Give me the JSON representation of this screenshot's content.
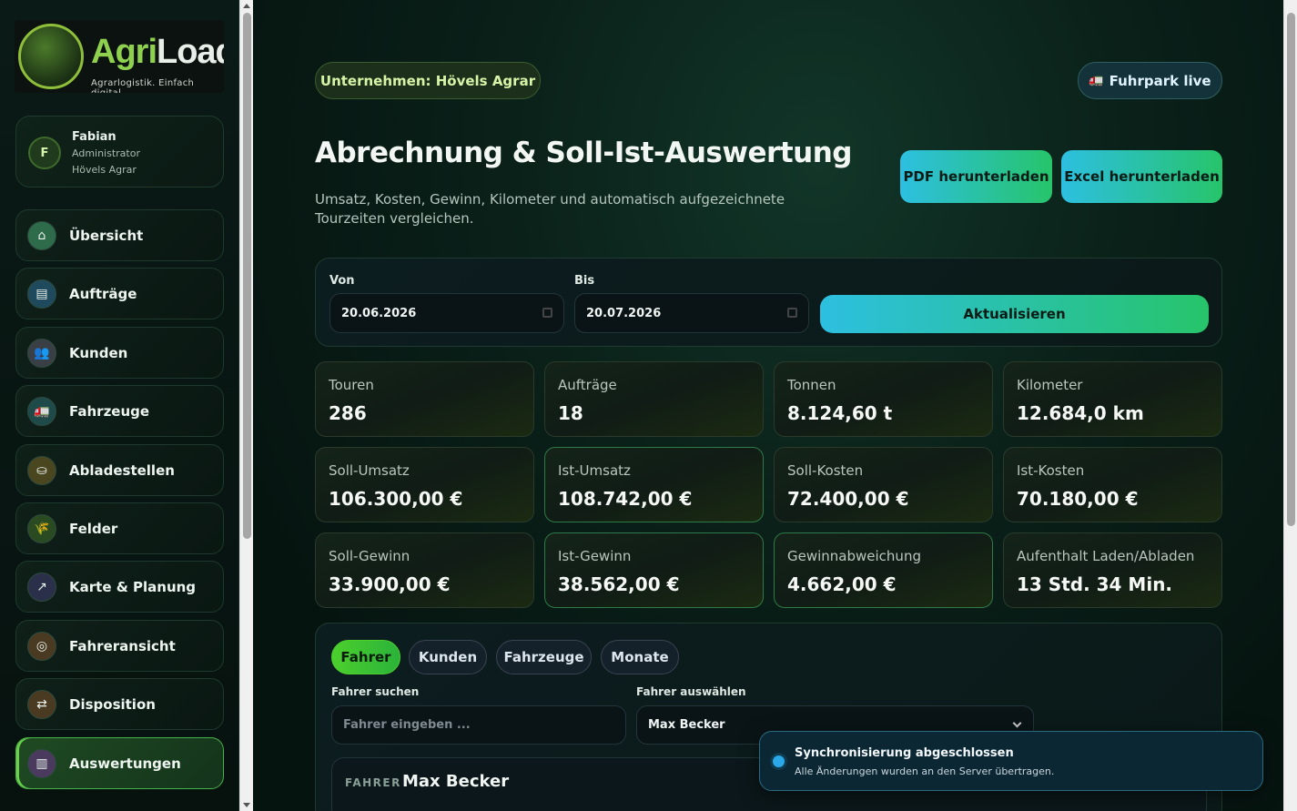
{
  "brand": {
    "name_a": "Agri",
    "name_b": "Load",
    "tagline": "Agrarlogistik. Einfach digital."
  },
  "user": {
    "initial": "F",
    "name": "Fabian",
    "role": "Administrator",
    "org": "Hövels Agrar"
  },
  "sidebar": {
    "items": [
      {
        "label": "Übersicht",
        "icon": "home-icon",
        "glyph": "⌂",
        "color": "#2e6b4a"
      },
      {
        "label": "Aufträge",
        "icon": "list-icon",
        "glyph": "▤",
        "color": "#1f4a5e"
      },
      {
        "label": "Kunden",
        "icon": "people-icon",
        "glyph": "👥",
        "color": "#3a3f46"
      },
      {
        "label": "Fahrzeuge",
        "icon": "truck-icon",
        "glyph": "🚛",
        "color": "#1f4a4a"
      },
      {
        "label": "Abladestellen",
        "icon": "silo-icon",
        "glyph": "⛀",
        "color": "#4a4620"
      },
      {
        "label": "Felder",
        "icon": "wheat-icon",
        "glyph": "🌾",
        "color": "#2a4a22"
      },
      {
        "label": "Karte & Planung",
        "icon": "map-icon",
        "glyph": "↗",
        "color": "#2a2f4a"
      },
      {
        "label": "Fahreransicht",
        "icon": "steering-icon",
        "glyph": "◎",
        "color": "#4a3a22"
      },
      {
        "label": "Disposition",
        "icon": "swap-icon",
        "glyph": "⇄",
        "color": "#4a3a22"
      },
      {
        "label": "Auswertungen",
        "icon": "chart-icon",
        "glyph": "▥",
        "color": "#4a3a5e"
      }
    ]
  },
  "header": {
    "company": "Unternehmen: Hövels Agrar",
    "fleet": "Fuhrpark live",
    "fleet_icon": "truck-icon"
  },
  "page": {
    "title": "Abrechnung & Soll-Ist-Auswertung",
    "description": "Umsatz, Kosten, Gewinn, Kilometer und automatisch aufgezeichnete Tourzeiten vergleichen.",
    "pdf_label": "PDF herunterladen",
    "excel_label": "Excel herunterladen"
  },
  "filter": {
    "from_label": "Von",
    "from_value": "20.06.2026",
    "to_label": "Bis",
    "to_value": "20.07.2026",
    "update_label": "Aktualisieren"
  },
  "kpis": [
    {
      "label": "Touren",
      "value": "286"
    },
    {
      "label": "Aufträge",
      "value": "18"
    },
    {
      "label": "Tonnen",
      "value": "8.124,60 t"
    },
    {
      "label": "Kilometer",
      "value": "12.684,0 km"
    },
    {
      "label": "Soll-Umsatz",
      "value": "106.300,00 €"
    },
    {
      "label": "Ist-Umsatz",
      "value": "108.742,00 €"
    },
    {
      "label": "Soll-Kosten",
      "value": "72.400,00 €"
    },
    {
      "label": "Ist-Kosten",
      "value": "70.180,00 €"
    },
    {
      "label": "Soll-Gewinn",
      "value": "33.900,00 €"
    },
    {
      "label": "Ist-Gewinn",
      "value": "38.562,00 €"
    },
    {
      "label": "Gewinnabweichung",
      "value": "4.662,00 €"
    },
    {
      "label": "Aufenthalt Laden/Abladen",
      "value": "13 Std. 34 Min."
    }
  ],
  "tabs": [
    "Fahrer",
    "Kunden",
    "Fahrzeuge",
    "Monate"
  ],
  "driver_filter": {
    "search_label": "Fahrer suchen",
    "search_placeholder": "Fahrer eingeben ...",
    "select_label": "Fahrer auswählen",
    "select_value": "Max Becker"
  },
  "driver_card": {
    "tag": "FAHRER",
    "name": "Max Becker"
  },
  "toast": {
    "title": "Synchronisierung abgeschlossen",
    "text": "Alle Änderungen wurden an den Server übertragen."
  }
}
